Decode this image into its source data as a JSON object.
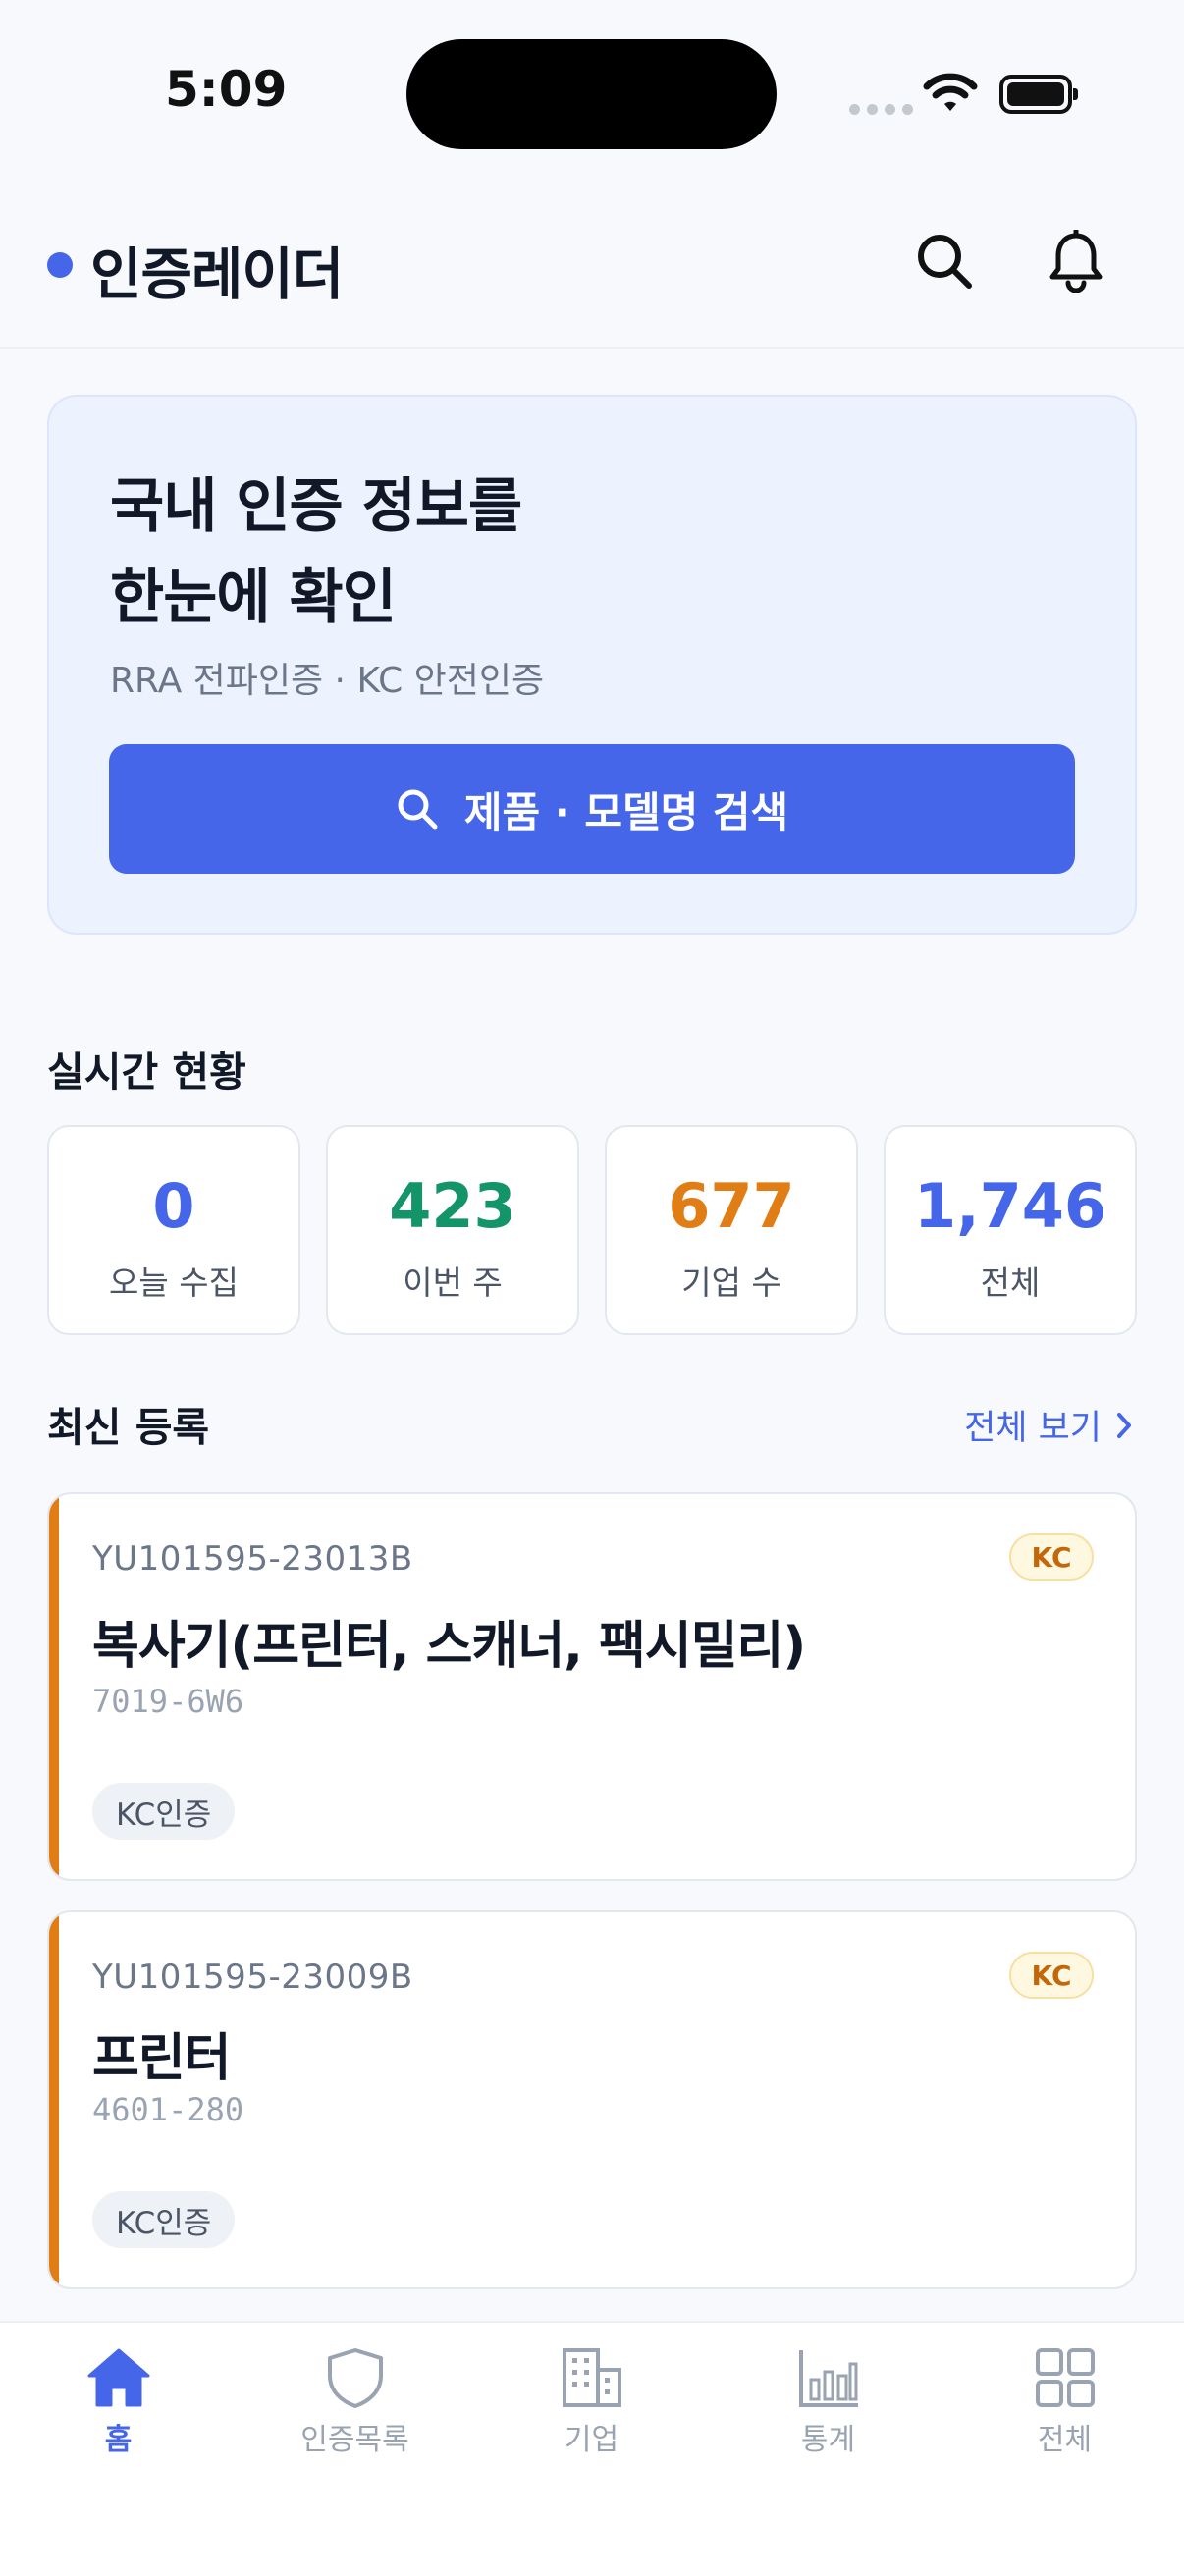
{
  "status_bar": {
    "time": "5:09"
  },
  "header": {
    "app_name": "인증레이더"
  },
  "hero": {
    "title": "국내 인증 정보를\n한눈에 확인",
    "subtitle": "RRA 전파인증 · KC 안전인증",
    "search_button_label": "제품 · 모델명 검색"
  },
  "stats": {
    "title": "실시간 현황",
    "items": [
      {
        "value": "0",
        "label": "오늘 수집",
        "color": "#4566e8"
      },
      {
        "value": "423",
        "label": "이번 주",
        "color": "#149469"
      },
      {
        "value": "677",
        "label": "기업 수",
        "color": "#e07d14"
      },
      {
        "value": "1,746",
        "label": "전체",
        "color": "#4566e8"
      }
    ]
  },
  "latest": {
    "title": "최신 등록",
    "see_all": "전체 보기",
    "items": [
      {
        "id": "YU101595-23013B",
        "badge": "KC",
        "title": "복사기(프린터, 스캐너, 팩시밀리)",
        "model": "7019-6W6",
        "tag": "KC인증"
      },
      {
        "id": "YU101595-23009B",
        "badge": "KC",
        "title": "프린터",
        "model": "4601-280",
        "tag": "KC인증"
      }
    ]
  },
  "nav": {
    "items": [
      {
        "label": "홈",
        "icon": "home-icon",
        "active": true
      },
      {
        "label": "인증목록",
        "icon": "shield-icon",
        "active": false
      },
      {
        "label": "기업",
        "icon": "building-icon",
        "active": false
      },
      {
        "label": "통계",
        "icon": "bar-chart-icon",
        "active": false
      },
      {
        "label": "전체",
        "icon": "grid-icon",
        "active": false
      }
    ]
  },
  "colors": {
    "accent": "#4566e8",
    "kc_orange": "#e07d14",
    "green": "#149469"
  }
}
